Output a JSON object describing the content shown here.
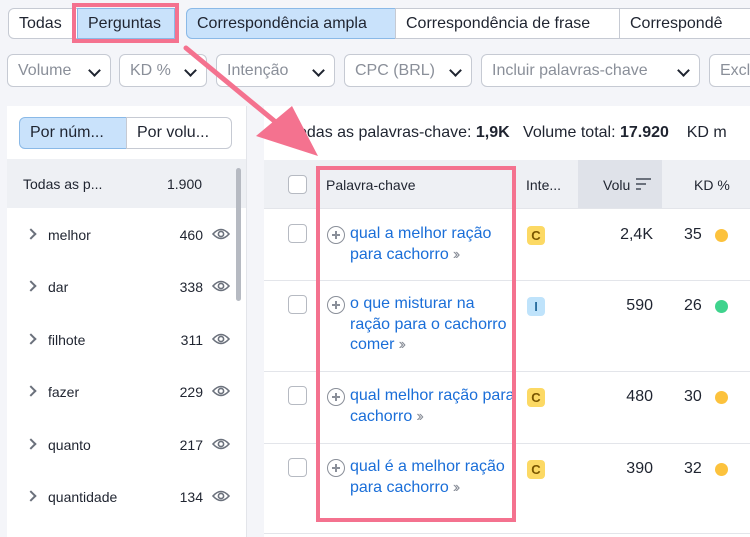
{
  "tabs": [
    "Todas",
    "Perguntas",
    "Correspondência ampla",
    "Correspondência de frase",
    "Correspondê"
  ],
  "filters": [
    "Volume",
    "KD %",
    "Intenção",
    "CPC (BRL)",
    "Incluir palavras-chave",
    "Excl"
  ],
  "left": {
    "segments": [
      "Por núm...",
      "Por volu..."
    ],
    "header": {
      "name": "Todas as p...",
      "count": "1.900"
    },
    "groups": [
      {
        "name": "melhor",
        "count": "460"
      },
      {
        "name": "dar",
        "count": "338"
      },
      {
        "name": "filhote",
        "count": "311"
      },
      {
        "name": "fazer",
        "count": "229"
      },
      {
        "name": "quanto",
        "count": "217"
      },
      {
        "name": "quantidade",
        "count": "134"
      }
    ]
  },
  "summary": {
    "all_label": "Todas as palavras-chave:",
    "all_value": "1,9K",
    "vol_label": "Volume total:",
    "vol_value": "17.920",
    "kd_label": "KD m"
  },
  "columns": {
    "keyword": "Palavra-chave",
    "intent": "Inte...",
    "volume": "Volu",
    "kd": "KD %"
  },
  "rows": [
    {
      "keyword": "qual a melhor ração para cachorro",
      "intent": "C",
      "volume": "2,4K",
      "kd": "35",
      "kd_color": "#fcc23d"
    },
    {
      "keyword": "o que misturar na ração para o cachorro comer",
      "intent": "I",
      "volume": "590",
      "kd": "26",
      "kd_color": "#3fd38d"
    },
    {
      "keyword": "qual melhor ração para cachorro",
      "intent": "C",
      "volume": "480",
      "kd": "30",
      "kd_color": "#fcc23d"
    },
    {
      "keyword": "qual é a melhor ração para cachorro",
      "intent": "C",
      "volume": "390",
      "kd": "32",
      "kd_color": "#fcc23d"
    }
  ],
  "colors": {
    "accent": "#1a6ed8",
    "annotation": "#f4728f",
    "active_tab": "#c9e2fb"
  },
  "icons": [
    "eye-icon",
    "plus-circle-icon",
    "double-chevron-icon",
    "sort-icon",
    "chevron-down-icon",
    "chevron-right-icon"
  ]
}
